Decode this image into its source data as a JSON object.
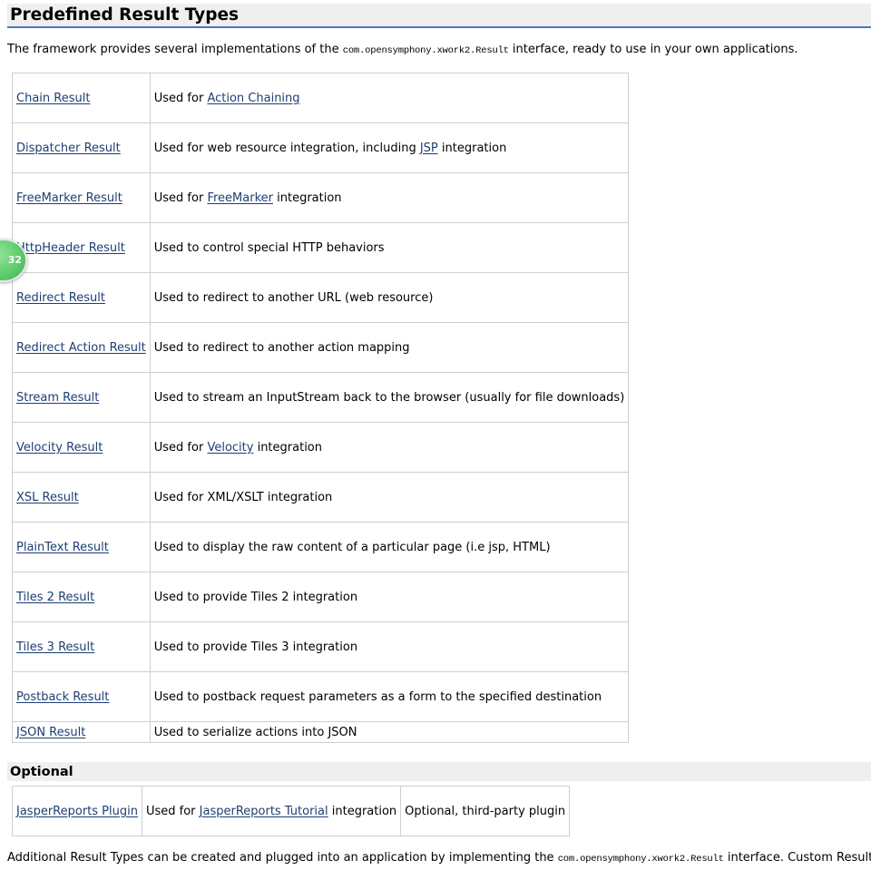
{
  "heading": "Predefined Result Types",
  "intro": {
    "before": "The framework provides several implementations of the ",
    "code": "com.opensymphony.xwork2.Result",
    "after": " interface, ready to use in your own applications."
  },
  "result_types": [
    {
      "name": "Chain Result",
      "desc_before": "Used for ",
      "desc_link": "Action Chaining",
      "desc_after": ""
    },
    {
      "name": "Dispatcher Result",
      "desc_before": "Used for web resource integration, including ",
      "desc_link": "JSP",
      "desc_after": " integration"
    },
    {
      "name": "FreeMarker Result",
      "desc_before": "Used for ",
      "desc_link": "FreeMarker",
      "desc_after": " integration"
    },
    {
      "name": "HttpHeader Result",
      "desc_before": "Used to control special HTTP behaviors",
      "desc_link": "",
      "desc_after": ""
    },
    {
      "name": "Redirect Result",
      "desc_before": "Used to redirect to another URL (web resource)",
      "desc_link": "",
      "desc_after": ""
    },
    {
      "name": "Redirect Action Result",
      "desc_before": "Used to redirect to another action mapping",
      "desc_link": "",
      "desc_after": ""
    },
    {
      "name": "Stream Result",
      "desc_before": "Used to stream an InputStream back to the browser (usually for file downloads)",
      "desc_link": "",
      "desc_after": ""
    },
    {
      "name": "Velocity Result",
      "desc_before": "Used for ",
      "desc_link": "Velocity",
      "desc_after": " integration"
    },
    {
      "name": "XSL Result",
      "desc_before": "Used for XML/XSLT integration",
      "desc_link": "",
      "desc_after": ""
    },
    {
      "name": "PlainText Result",
      "desc_before": "Used to display the raw content of a particular page (i.e jsp, HTML)",
      "desc_link": "",
      "desc_after": ""
    },
    {
      "name": "Tiles 2 Result",
      "desc_before": "Used to provide Tiles 2 integration",
      "desc_link": "",
      "desc_after": ""
    },
    {
      "name": "Tiles 3 Result",
      "desc_before": "Used to provide Tiles 3 integration",
      "desc_link": "",
      "desc_after": ""
    },
    {
      "name": "Postback Result",
      "desc_before": "Used to postback request parameters as a form to the specified destination",
      "desc_link": "",
      "desc_after": ""
    },
    {
      "name": "JSON Result",
      "desc_before": "Used to serialize actions into JSON",
      "desc_link": "",
      "desc_after": ""
    }
  ],
  "optional": {
    "heading": "Optional",
    "rows": [
      {
        "name": "JasperReports Plugin",
        "desc_before": "Used for ",
        "desc_link": "JasperReports Tutorial",
        "desc_after": " integration",
        "note": "Optional, third-party plugin"
      }
    ]
  },
  "footer": {
    "before": "Additional Result Types can be created and plugged into an application by implementing the ",
    "code": "com.opensymphony.xwork2.Result",
    "after": " interface. Custom Result Types"
  },
  "badge": {
    "label": "32"
  },
  "colors": {
    "link": "#1d3e73",
    "heading_band": "#efefef",
    "heading_rule": "#4a78b5",
    "table_border": "#cfcfcf",
    "badge": "#5fcc6d"
  }
}
